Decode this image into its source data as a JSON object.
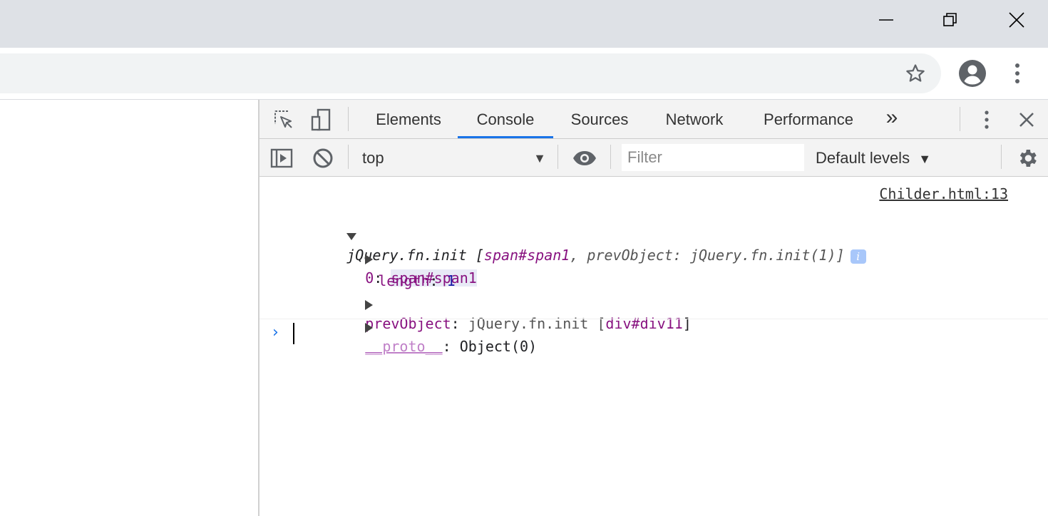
{
  "window": {
    "controls": [
      "minimize-icon",
      "restore-icon",
      "close-icon"
    ]
  },
  "toolbar": {
    "icons": [
      "star-icon",
      "account-icon",
      "kebab-menu-icon"
    ]
  },
  "devtools": {
    "tabs": [
      {
        "label": "Elements"
      },
      {
        "label": "Console",
        "active": true
      },
      {
        "label": "Sources"
      },
      {
        "label": "Network"
      },
      {
        "label": "Performance"
      }
    ],
    "more_tabs_label": "»",
    "console_bar": {
      "context": "top",
      "filter_placeholder": "Filter",
      "levels": "Default levels"
    },
    "accent_color": "#1a73e8"
  },
  "console": {
    "source_link": "Childer.html:13",
    "entry": {
      "summary_head": "jQuery.fn.init [",
      "summary_item": "span#span1",
      "summary_prev": ", prevObject: jQuery.fn.init(1)]",
      "info_badge": "i",
      "rows": {
        "r0_key": "0",
        "r0_value": "span#span1",
        "length_key": "length",
        "length_value": "1",
        "prev_key": "prevObject",
        "prev_value_head": "jQuery.fn.init [",
        "prev_value_item": "div#div11",
        "prev_value_tail": "]",
        "proto_key": "__proto__",
        "proto_value": "Object(0)"
      }
    },
    "prompt_symbol": "›"
  }
}
